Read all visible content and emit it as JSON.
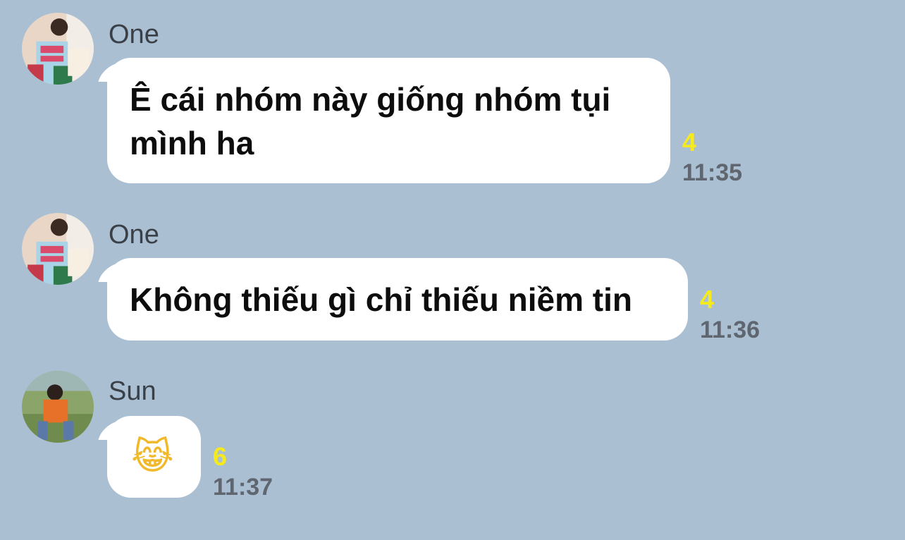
{
  "messages": [
    {
      "sender": "One",
      "avatar_icon": "profile-photo-gentle-jelly",
      "text": "Ê cái nhóm này giống nhóm tụi mình ha",
      "read_count": "4",
      "time": "11:35"
    },
    {
      "sender": "One",
      "avatar_icon": "profile-photo-gentle-jelly",
      "text": "Không thiếu gì chỉ thiếu niềm tin",
      "read_count": "4",
      "time": "11:36"
    },
    {
      "sender": "Sun",
      "avatar_icon": "profile-photo-outdoor",
      "text": "😹",
      "read_count": "6",
      "time": "11:37"
    }
  ],
  "colors": {
    "background": "#abbfd3",
    "bubble": "#ffffff",
    "read_count": "#f5ea1e",
    "time": "#5f6670"
  }
}
